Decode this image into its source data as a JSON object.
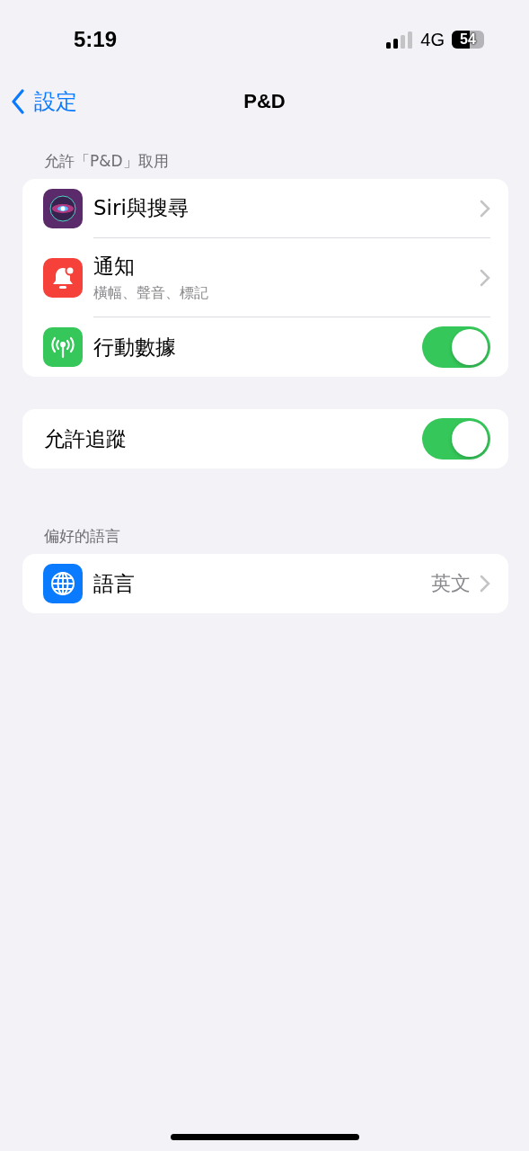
{
  "status_bar": {
    "time": "5:19",
    "network": "4G",
    "battery": "54"
  },
  "nav": {
    "back": "設定",
    "title": "P&D"
  },
  "sections": [
    {
      "header": "允許「P&D」取用",
      "rows": [
        {
          "kind": "link",
          "title": "Siri與搜尋",
          "color": "#5a2a6a"
        },
        {
          "kind": "link",
          "title": "通知",
          "subtitle": "橫幅、聲音、標記",
          "color": "#f5413a"
        },
        {
          "kind": "toggle",
          "title": "行動數據",
          "on": true,
          "color": "#35c759"
        }
      ]
    },
    {
      "rows": [
        {
          "kind": "toggle",
          "title": "允許追蹤",
          "on": true
        }
      ]
    },
    {
      "header": "偏好的語言",
      "rows": [
        {
          "kind": "link",
          "title": "語言",
          "value": "英文",
          "color": "#0a7aff"
        }
      ]
    }
  ]
}
